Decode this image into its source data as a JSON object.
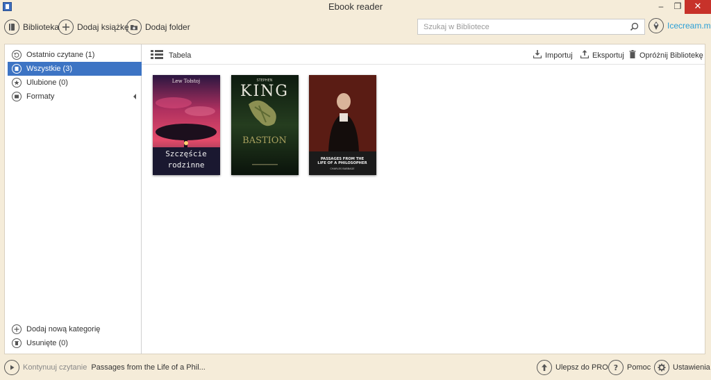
{
  "window": {
    "title": "Ebook reader",
    "minimize": "–",
    "maximize": "❐",
    "close": "✕"
  },
  "toolbar": {
    "library_label": "Biblioteka",
    "add_book_label": "Dodaj książkę",
    "add_folder_label": "Dodaj folder",
    "search_placeholder": "Szukaj w Bibliotece",
    "brand_label": "Icecream.me"
  },
  "sidebar": {
    "items": [
      {
        "label": "Ostatnio czytane (1)",
        "icon": "recent-icon"
      },
      {
        "label": "Wszystkie (3)",
        "icon": "all-books-icon",
        "active": true
      },
      {
        "label": "Ulubione (0)",
        "icon": "star-icon"
      },
      {
        "label": "Formaty",
        "icon": "formats-icon"
      }
    ],
    "bottom": [
      {
        "label": "Dodaj nową kategorię",
        "icon": "plus-icon"
      },
      {
        "label": "Usunięte (0)",
        "icon": "trash-icon"
      }
    ]
  },
  "main": {
    "view_label": "Tabela",
    "actions": {
      "import": "Importuj",
      "export": "Eksportuj",
      "clear": "Opróżnij Bibliotekę"
    },
    "books": [
      {
        "author": "Lew Tołstoj",
        "title_line1": "Szczęście",
        "title_line2": "rodzinne"
      },
      {
        "author": "STEPHEN",
        "title_line1": "KING",
        "title_line2": "BASTION"
      },
      {
        "author": "CHARLES BABBAGE",
        "title_line1": "PASSAGES FROM THE",
        "title_line2": "LIFE OF A PHILOSOPHER"
      }
    ]
  },
  "status": {
    "continue_label": "Kontynuuj czytanie",
    "continue_title": "Passages from the Life of a Phil...",
    "upgrade_label": "Ulepsz do PRO",
    "help_label": "Pomoc",
    "settings_label": "Ustawienia"
  },
  "colors": {
    "accent": "#3d74c4",
    "brand": "#2a9fd6",
    "background": "#f5ecd9",
    "close": "#c7322a"
  }
}
